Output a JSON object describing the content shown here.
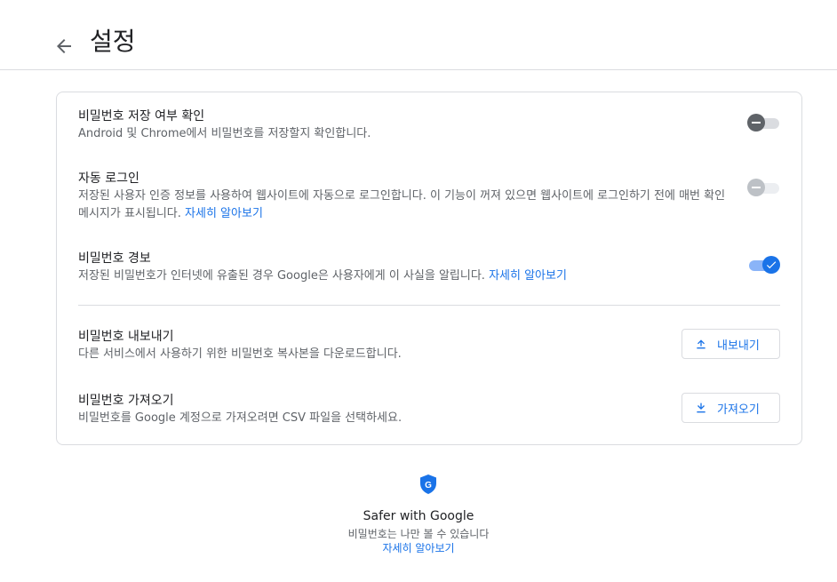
{
  "header": {
    "title": "설정",
    "back_icon": "arrow-back-icon"
  },
  "settings": {
    "offer_to_save": {
      "title": "비밀번호 저장 여부 확인",
      "desc": "Android 및 Chrome에서 비밀번호를 저장할지 확인합니다.",
      "state": "off"
    },
    "auto_signin": {
      "title": "자동 로그인",
      "desc": "저장된 사용자 인증 정보를 사용하여 웹사이트에 자동으로 로그인합니다. 이 기능이 꺼져 있으면 웹사이트에 로그인하기 전에 매번 확인 메시지가 표시됩니다.",
      "link": "자세히 알아보기",
      "state": "off-disabled"
    },
    "password_alerts": {
      "title": "비밀번호 경보",
      "desc": "저장된 비밀번호가 인터넷에 유출된 경우 Google은 사용자에게 이 사실을 알립니다.",
      "link": "자세히 알아보기",
      "state": "on"
    },
    "export": {
      "title": "비밀번호 내보내기",
      "desc": "다른 서비스에서 사용하기 위한 비밀번호 복사본을 다운로드합니다.",
      "button": "내보내기",
      "icon": "upload-icon"
    },
    "import": {
      "title": "비밀번호 가져오기",
      "desc": "비밀번호를 Google 계정으로 가져오려면 CSV 파일을 선택하세요.",
      "button": "가져오기",
      "icon": "download-icon"
    }
  },
  "footer": {
    "icon": "google-shield-icon",
    "title": "Safer with Google",
    "subtitle": "비밀번호는 나만 볼 수 있습니다",
    "link": "자세히 알아보기"
  },
  "colors": {
    "accent": "#1a73e8",
    "border": "#dadce0",
    "secondary_text": "#5f6368"
  }
}
